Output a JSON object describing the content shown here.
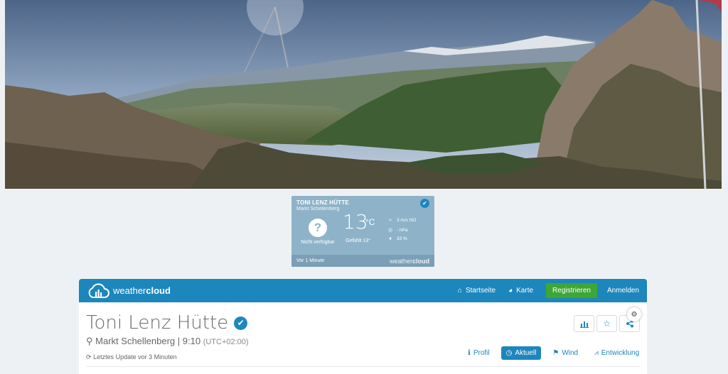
{
  "widget": {
    "station_name": "TONI LENZ HÜTTE",
    "location": "Markt Schellenberg",
    "condition_text": "Nicht verfügbar",
    "temperature": "13",
    "temperature_unit": "°C",
    "feels_like": "Gefühlt 13°",
    "wind": "3 m/s NO",
    "pressure": "- hPa",
    "humidity": "33 %",
    "updated": "Vor 1 Minute",
    "brand_light": "weather",
    "brand_bold": "cloud"
  },
  "navbar": {
    "logo_light": "weather",
    "logo_bold": "cloud",
    "items": [
      {
        "label": "Startseite",
        "icon": "home-icon"
      },
      {
        "label": "Karte",
        "icon": "globe-icon"
      }
    ],
    "register_label": "Registrieren",
    "login_label": "Anmelden"
  },
  "station": {
    "title": "Toni Lenz Hütte",
    "location": "Markt Schellenberg | 9:10",
    "timezone": "(UTC+02:00)",
    "last_update": "Letztes Update vor 3 Minuten"
  },
  "tabs": [
    {
      "label": "Profil",
      "icon": "info-icon",
      "active": false
    },
    {
      "label": "Aktuell",
      "icon": "clock-icon",
      "active": true
    },
    {
      "label": "Wind",
      "icon": "windsock-icon",
      "active": false
    },
    {
      "label": "Entwicklung",
      "icon": "line-chart-icon",
      "active": false
    }
  ],
  "colors": {
    "primary": "#1d86bd",
    "register": "#3da636",
    "widget_bg": "#8eb3c9"
  }
}
